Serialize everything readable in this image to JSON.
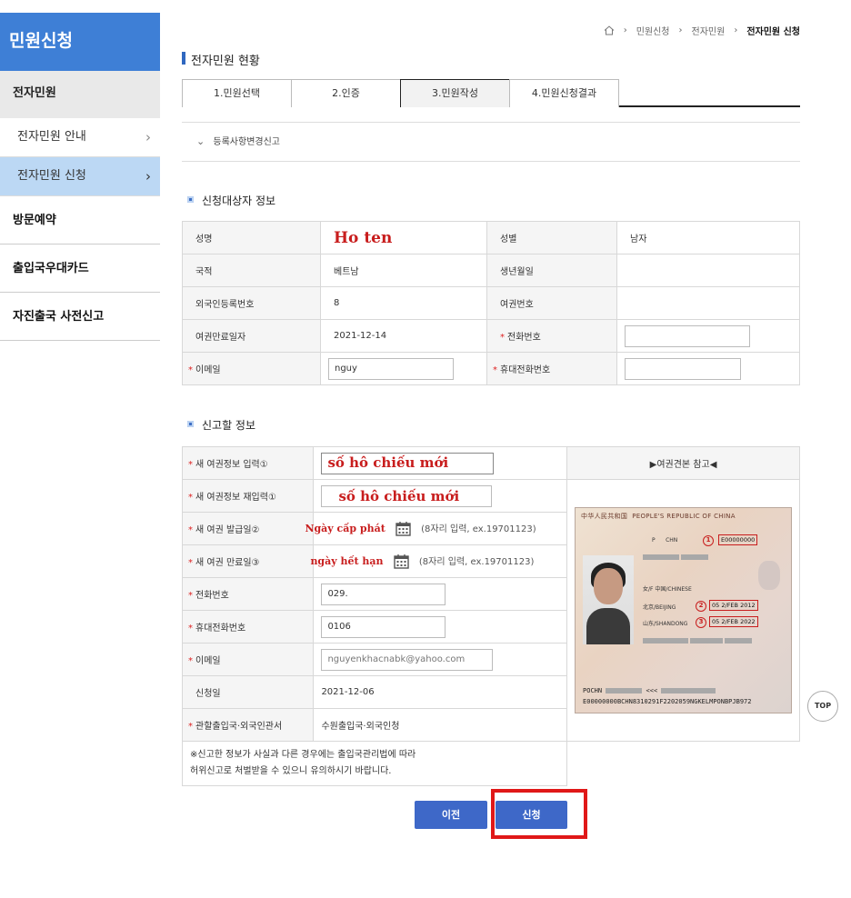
{
  "sidebar": {
    "title": "민원신청",
    "section": "전자민원",
    "items": [
      {
        "label": "전자민원 안내"
      },
      {
        "label": "전자민원 신청"
      }
    ],
    "menus": [
      "방문예약",
      "출입국우대카드",
      "자진출국 사전신고"
    ]
  },
  "breadcrumb": [
    "민원신청",
    "전자민원",
    "전자민원 신청"
  ],
  "page_title": "전자민원 현황",
  "tabs": [
    "1.민원선택",
    "2.인증",
    "3.민원작성",
    "4.민원신청결과"
  ],
  "active_tab": 2,
  "collapse_label": "등록사항변경신고",
  "applicant": {
    "heading": "신청대상자 정보",
    "name_label": "성명",
    "name_value": "Ho ten",
    "gender_label": "성별",
    "gender_value": "남자",
    "nationality_label": "국적",
    "nationality_value": "베트남",
    "birth_label": "생년월일",
    "birth_value": "",
    "alien_reg_label": "외국인등록번호",
    "alien_reg_value": "8",
    "passport_no_label": "여권번호",
    "passport_no_value": "",
    "passport_expiry_label": "여권만료일자",
    "passport_expiry_value": "2021-12-14",
    "phone_label": "전화번호",
    "phone_value": "",
    "email_label": "이메일",
    "email_value": "nguy",
    "mobile_label": "휴대전화번호",
    "mobile_value": ""
  },
  "report": {
    "heading": "신고할 정보",
    "new_passport_label": "새 여권정보 입력①",
    "new_passport_value": "số hô chiếu mới",
    "new_passport_re_label": "새 여권정보 재입력①",
    "new_passport_re_value": "số hô chiếu mới",
    "issue_date_label": "새 여권 발급일②",
    "issue_date_value": "Ngày cấp phát",
    "expiry_date_label": "새 여권 만료일③",
    "expiry_date_value": "ngày hết hạn",
    "date_hint": "(8자리 입력, ex.19701123)",
    "phone_label": "전화번호",
    "phone_value": "029.",
    "mobile_label": "휴대전화번호",
    "mobile_value": "0106",
    "email_label": "이메일",
    "email_value": "nguyenkhacnabk@yahoo.com",
    "apply_date_label": "신청일",
    "apply_date_value": "2021-12-06",
    "office_label": "관할출입국·외국인관서",
    "office_value": "수원출입국·외국인청",
    "notice_line1": "※신고한 정보가 사실과 다른 경우에는 출입국관리법에 따라",
    "notice_line2": "허위신고로 처벌받을 수 있으니 유의하시기 바랍니다.",
    "reference_label": "▶여권견본 참고◀"
  },
  "passport_sample": {
    "header_cn": "中华人民共和国",
    "header_en": "PEOPLE'S REPUBLIC OF CHINA",
    "type": "P",
    "country": "CHN",
    "number": "E00000000",
    "sex_nat": "女/F  中国/CHINESE",
    "birth_place": "北京/BEIJING",
    "issue_place": "山东/SHANDONG",
    "issue_date": "05 2/FEB 2012",
    "expiry_date": "05 2/FEB 2022",
    "mrz1": "POCHN",
    "mrz2": "E00000000BCHN8310291F2202059NGKELMPONBPJB972"
  },
  "buttons": {
    "prev": "이전",
    "submit": "신청",
    "top": "TOP"
  }
}
